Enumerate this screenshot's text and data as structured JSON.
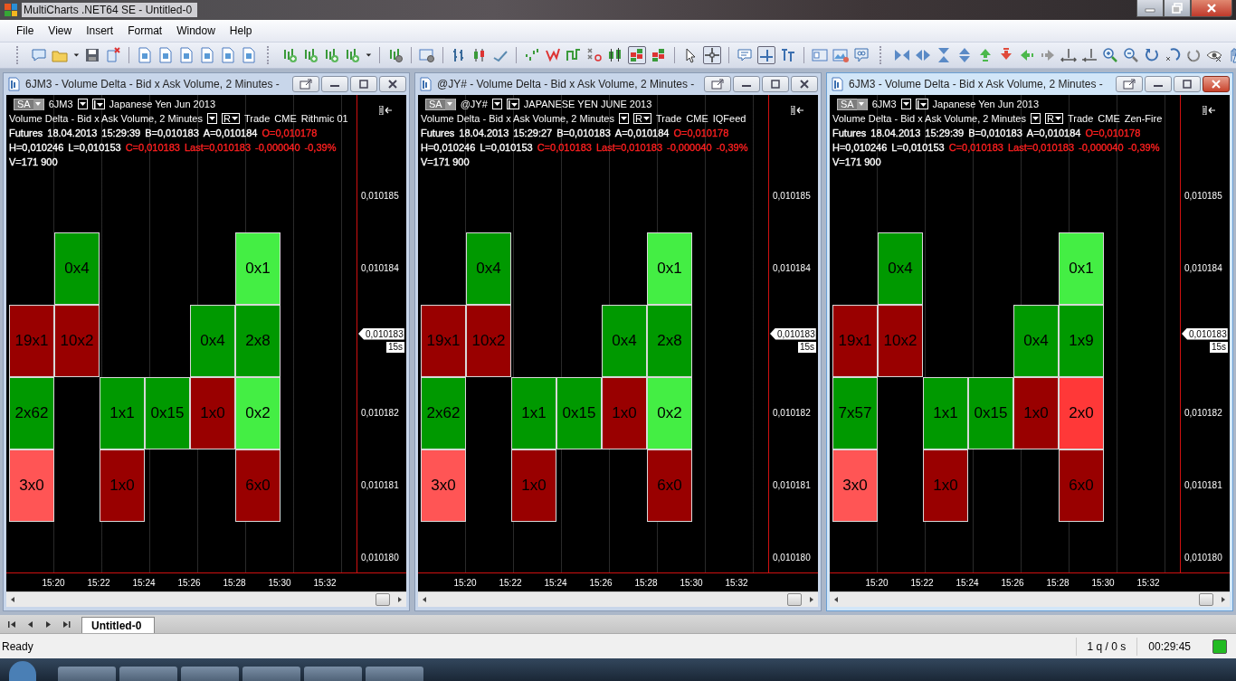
{
  "app": {
    "title": "MultiCharts .NET64 SE - Untitled-0"
  },
  "menu": [
    {
      "label": "File"
    },
    {
      "label": "View"
    },
    {
      "label": "Insert"
    },
    {
      "label": "Format"
    },
    {
      "label": "Window"
    },
    {
      "label": "Help"
    }
  ],
  "windows": [
    {
      "title": "6JM3 - Volume Delta - Bid x Ask Volume, 2 Minutes -",
      "active": false,
      "header": {
        "style_button": "SA",
        "symbol": "6JM3",
        "description": "Japanese Yen Jun 2013",
        "indicator": "Volume Delta - Bid x Ask Volume, 2 Minutes",
        "resolution_button": "R",
        "source": [
          "Trade",
          "CME",
          "Rithmic 01"
        ],
        "lines": [
          [
            {
              "text": "Futures",
              "color": "#ffffff"
            },
            {
              "text": "18.04.2013",
              "color": "#ffffff"
            },
            {
              "text": "15:29:39",
              "color": "#ffffff"
            },
            {
              "text": "B=0,010183",
              "color": "#ffffff"
            },
            {
              "text": "A=0,010184",
              "color": "#ffffff"
            },
            {
              "text": "O=0,010178",
              "color": "#ff2020"
            }
          ],
          [
            {
              "text": "H=0,010246",
              "color": "#ffffff"
            },
            {
              "text": "L=0,010153",
              "color": "#ffffff"
            },
            {
              "text": "C=0,010183",
              "color": "#ff2020"
            },
            {
              "text": "Last=0,010183",
              "color": "#ff2020"
            },
            {
              "text": "-0,000040",
              "color": "#ff2020"
            },
            {
              "text": "-0,39%",
              "color": "#ff2020"
            }
          ],
          [
            {
              "text": "V=171 900",
              "color": "#ffffff"
            }
          ]
        ]
      },
      "price_axis": {
        "ticks": [
          {
            "kind": "tick",
            "label": "0,010185"
          },
          {
            "kind": "tick",
            "label": "0,010184"
          },
          {
            "kind": "last",
            "label": "0,010183",
            "countdown": "15s"
          },
          {
            "kind": "tick",
            "label": "0,010182"
          },
          {
            "kind": "tick",
            "label": "0,010181"
          },
          {
            "kind": "tick",
            "label": "0,010180"
          }
        ]
      },
      "time_axis": [
        "15:20",
        "15:22",
        "15:24",
        "15:26",
        "15:28",
        "15:30",
        "15:32"
      ],
      "columns": [
        {
          "cells": [
            {
              "kind": "blank"
            },
            {
              "kind": "bar",
              "text": "19x1",
              "color": "#990000"
            },
            {
              "kind": "bar",
              "text": "2x62",
              "color": "#009900"
            },
            {
              "kind": "bar",
              "text": "3x0",
              "color": "#ff5555"
            }
          ]
        },
        {
          "cells": [
            {
              "kind": "bar",
              "text": "0x4",
              "color": "#009900"
            },
            {
              "kind": "bar",
              "text": "10x2",
              "color": "#990000"
            },
            {
              "kind": "blank"
            },
            {
              "kind": "blank"
            }
          ]
        },
        {
          "cells": [
            {
              "kind": "blank"
            },
            {
              "kind": "blank"
            },
            {
              "kind": "bar",
              "text": "1x1",
              "color": "#009900"
            },
            {
              "kind": "bar",
              "text": "1x0",
              "color": "#990000"
            }
          ]
        },
        {
          "cells": [
            {
              "kind": "blank"
            },
            {
              "kind": "blank"
            },
            {
              "kind": "bar",
              "text": "0x15",
              "color": "#009900"
            },
            {
              "kind": "blank"
            }
          ]
        },
        {
          "cells": [
            {
              "kind": "blank"
            },
            {
              "kind": "bar",
              "text": "0x4",
              "color": "#009900"
            },
            {
              "kind": "bar",
              "text": "1x0",
              "color": "#990000"
            },
            {
              "kind": "blank"
            }
          ]
        },
        {
          "cells": [
            {
              "kind": "bar",
              "text": "0x1",
              "color": "#44ee44"
            },
            {
              "kind": "bar",
              "text": "2x8",
              "color": "#009900"
            },
            {
              "kind": "bar",
              "text": "0x2",
              "color": "#44ee44"
            },
            {
              "kind": "bar",
              "text": "6x0",
              "color": "#990000"
            }
          ]
        }
      ]
    },
    {
      "title": "@JY# - Volume Delta - Bid x Ask Volume, 2 Minutes -",
      "active": false,
      "header": {
        "style_button": "SA",
        "symbol": "@JY#",
        "description": "JAPANESE YEN JUNE 2013",
        "indicator": "Volume Delta - Bid x Ask Volume, 2 Minutes",
        "resolution_button": "R",
        "source": [
          "Trade",
          "CME",
          "IQFeed"
        ],
        "lines": [
          [
            {
              "text": "Futures",
              "color": "#ffffff"
            },
            {
              "text": "18.04.2013",
              "color": "#ffffff"
            },
            {
              "text": "15:29:27",
              "color": "#ffffff"
            },
            {
              "text": "B=0,010183",
              "color": "#ffffff"
            },
            {
              "text": "A=0,010184",
              "color": "#ffffff"
            },
            {
              "text": "O=0,010178",
              "color": "#ff2020"
            }
          ],
          [
            {
              "text": "H=0,010246",
              "color": "#ffffff"
            },
            {
              "text": "L=0,010153",
              "color": "#ffffff"
            },
            {
              "text": "C=0,010183",
              "color": "#ff2020"
            },
            {
              "text": "Last=0,010183",
              "color": "#ff2020"
            },
            {
              "text": "-0,000040",
              "color": "#ff2020"
            },
            {
              "text": "-0,39%",
              "color": "#ff2020"
            }
          ],
          [
            {
              "text": "V=171 900",
              "color": "#ffffff"
            }
          ]
        ]
      },
      "price_axis": {
        "ticks": [
          {
            "kind": "tick",
            "label": "0,010185"
          },
          {
            "kind": "tick",
            "label": "0,010184"
          },
          {
            "kind": "last",
            "label": "0,010183",
            "countdown": "15s"
          },
          {
            "kind": "tick",
            "label": "0,010182"
          },
          {
            "kind": "tick",
            "label": "0,010181"
          },
          {
            "kind": "tick",
            "label": "0,010180"
          }
        ]
      },
      "time_axis": [
        "15:20",
        "15:22",
        "15:24",
        "15:26",
        "15:28",
        "15:30",
        "15:32"
      ],
      "columns": [
        {
          "cells": [
            {
              "kind": "blank"
            },
            {
              "kind": "bar",
              "text": "19x1",
              "color": "#990000"
            },
            {
              "kind": "bar",
              "text": "2x62",
              "color": "#009900"
            },
            {
              "kind": "bar",
              "text": "3x0",
              "color": "#ff5555"
            }
          ]
        },
        {
          "cells": [
            {
              "kind": "bar",
              "text": "0x4",
              "color": "#009900"
            },
            {
              "kind": "bar",
              "text": "10x2",
              "color": "#990000"
            },
            {
              "kind": "blank"
            },
            {
              "kind": "blank"
            }
          ]
        },
        {
          "cells": [
            {
              "kind": "blank"
            },
            {
              "kind": "blank"
            },
            {
              "kind": "bar",
              "text": "1x1",
              "color": "#009900"
            },
            {
              "kind": "bar",
              "text": "1x0",
              "color": "#990000"
            }
          ]
        },
        {
          "cells": [
            {
              "kind": "blank"
            },
            {
              "kind": "blank"
            },
            {
              "kind": "bar",
              "text": "0x15",
              "color": "#009900"
            },
            {
              "kind": "blank"
            }
          ]
        },
        {
          "cells": [
            {
              "kind": "blank"
            },
            {
              "kind": "bar",
              "text": "0x4",
              "color": "#009900"
            },
            {
              "kind": "bar",
              "text": "1x0",
              "color": "#990000"
            },
            {
              "kind": "blank"
            }
          ]
        },
        {
          "cells": [
            {
              "kind": "bar",
              "text": "0x1",
              "color": "#44ee44"
            },
            {
              "kind": "bar",
              "text": "2x8",
              "color": "#009900"
            },
            {
              "kind": "bar",
              "text": "0x2",
              "color": "#44ee44"
            },
            {
              "kind": "bar",
              "text": "6x0",
              "color": "#990000"
            }
          ]
        }
      ]
    },
    {
      "title": "6JM3 - Volume Delta - Bid x Ask Volume, 2 Minutes -",
      "active": true,
      "header": {
        "style_button": "SA",
        "symbol": "6JM3",
        "description": "Japanese Yen Jun 2013",
        "indicator": "Volume Delta - Bid x Ask Volume, 2 Minutes",
        "resolution_button": "R",
        "source": [
          "Trade",
          "CME",
          "Zen-Fire"
        ],
        "lines": [
          [
            {
              "text": "Futures",
              "color": "#ffffff"
            },
            {
              "text": "18.04.2013",
              "color": "#ffffff"
            },
            {
              "text": "15:29:39",
              "color": "#ffffff"
            },
            {
              "text": "B=0,010183",
              "color": "#ffffff"
            },
            {
              "text": "A=0,010184",
              "color": "#ffffff"
            },
            {
              "text": "O=0,010178",
              "color": "#ff2020"
            }
          ],
          [
            {
              "text": "H=0,010246",
              "color": "#ffffff"
            },
            {
              "text": "L=0,010153",
              "color": "#ffffff"
            },
            {
              "text": "C=0,010183",
              "color": "#ff2020"
            },
            {
              "text": "Last=0,010183",
              "color": "#ff2020"
            },
            {
              "text": "-0,000040",
              "color": "#ff2020"
            },
            {
              "text": "-0,39%",
              "color": "#ff2020"
            }
          ],
          [
            {
              "text": "V=171 900",
              "color": "#ffffff"
            }
          ]
        ]
      },
      "price_axis": {
        "ticks": [
          {
            "kind": "tick",
            "label": "0,010185"
          },
          {
            "kind": "tick",
            "label": "0,010184"
          },
          {
            "kind": "last",
            "label": "0,010183",
            "countdown": "15s"
          },
          {
            "kind": "tick",
            "label": "0,010182"
          },
          {
            "kind": "tick",
            "label": "0,010181"
          },
          {
            "kind": "tick",
            "label": "0,010180"
          }
        ]
      },
      "time_axis": [
        "15:20",
        "15:22",
        "15:24",
        "15:26",
        "15:28",
        "15:30",
        "15:32"
      ],
      "columns": [
        {
          "cells": [
            {
              "kind": "blank"
            },
            {
              "kind": "bar",
              "text": "19x1",
              "color": "#990000"
            },
            {
              "kind": "bar",
              "text": "7x57",
              "color": "#009900"
            },
            {
              "kind": "bar",
              "text": "3x0",
              "color": "#ff5555"
            }
          ]
        },
        {
          "cells": [
            {
              "kind": "bar",
              "text": "0x4",
              "color": "#009900"
            },
            {
              "kind": "bar",
              "text": "10x2",
              "color": "#990000"
            },
            {
              "kind": "blank"
            },
            {
              "kind": "blank"
            }
          ]
        },
        {
          "cells": [
            {
              "kind": "blank"
            },
            {
              "kind": "blank"
            },
            {
              "kind": "bar",
              "text": "1x1",
              "color": "#009900"
            },
            {
              "kind": "bar",
              "text": "1x0",
              "color": "#990000"
            }
          ]
        },
        {
          "cells": [
            {
              "kind": "blank"
            },
            {
              "kind": "blank"
            },
            {
              "kind": "bar",
              "text": "0x15",
              "color": "#009900"
            },
            {
              "kind": "blank"
            }
          ]
        },
        {
          "cells": [
            {
              "kind": "blank"
            },
            {
              "kind": "bar",
              "text": "0x4",
              "color": "#009900"
            },
            {
              "kind": "bar",
              "text": "1x0",
              "color": "#990000"
            },
            {
              "kind": "blank"
            }
          ]
        },
        {
          "cells": [
            {
              "kind": "bar",
              "text": "0x1",
              "color": "#44ee44"
            },
            {
              "kind": "bar",
              "text": "1x9",
              "color": "#009900"
            },
            {
              "kind": "bar",
              "text": "2x0",
              "color": "#ff3838"
            },
            {
              "kind": "bar",
              "text": "6x0",
              "color": "#990000"
            }
          ]
        }
      ]
    }
  ],
  "sheet_tabs": [
    {
      "label": "Untitled-0",
      "selected": true
    }
  ],
  "status_bar": {
    "message": "Ready",
    "queue": "1 q / 0 s",
    "clock": "00:29:45",
    "connected": true
  }
}
